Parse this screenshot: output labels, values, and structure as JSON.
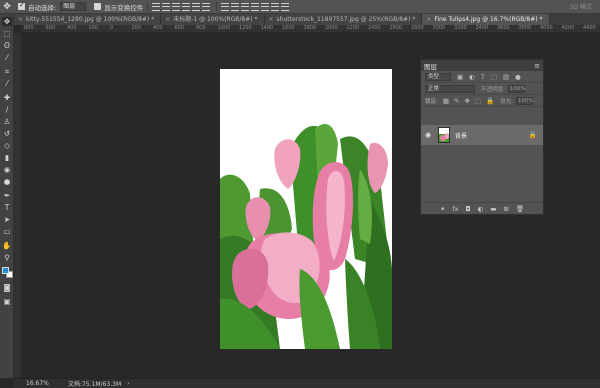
{
  "options_bar": {
    "auto_select_label": "自动选择:",
    "auto_select_value": "图层",
    "show_transform_label": "显示变换控件",
    "mode_label": "3D 模式:"
  },
  "tabs": [
    {
      "label": "kitty-551554_1280.jpg @ 100%(RGB/8#) *",
      "active": false
    },
    {
      "label": "未标题-1 @ 100%(RGB/8#) *",
      "active": false
    },
    {
      "label": "shutterstock_11897557.jpg @ 25%(RGB/8#) *",
      "active": false
    },
    {
      "label": "Fine Tulips4.jpg @ 16.7%(RGB/8#) *",
      "active": true
    }
  ],
  "ruler_labels": [
    "800",
    "600",
    "400",
    "200",
    "0",
    "200",
    "400",
    "600",
    "800",
    "1000",
    "1200",
    "1400",
    "1600",
    "1800",
    "2000",
    "2200",
    "2400",
    "2600",
    "2800",
    "3000",
    "3200",
    "3400",
    "3600",
    "3800",
    "4000",
    "4200",
    "4400"
  ],
  "toolbar_icons": [
    "move-icon",
    "marquee-icon",
    "lasso-icon",
    "magic-wand-icon",
    "crop-icon",
    "eyedropper-icon",
    "healing-brush-icon",
    "brush-icon",
    "clone-stamp-icon",
    "history-brush-icon",
    "eraser-icon",
    "gradient-icon",
    "blur-icon",
    "dodge-icon",
    "pen-icon",
    "type-icon",
    "path-select-icon",
    "rectangle-icon",
    "hand-icon",
    "zoom-icon"
  ],
  "layers_panel": {
    "title": "图层",
    "filter_kind": "类型",
    "blend_mode": "正常",
    "opacity_label": "不透明度:",
    "opacity_value": "100%",
    "lock_label": "锁定:",
    "fill_label": "填充:",
    "fill_value": "100%",
    "layer_name": "背景"
  },
  "status_bar": {
    "zoom": "16.67%",
    "doc_info": "文档:75.1M/63.3M"
  },
  "colors": {
    "foreground": "#1a8fd8",
    "background": "#ffffff",
    "tulip_pink": "#e77ea6",
    "leaf_green": "#3f8f2b"
  }
}
